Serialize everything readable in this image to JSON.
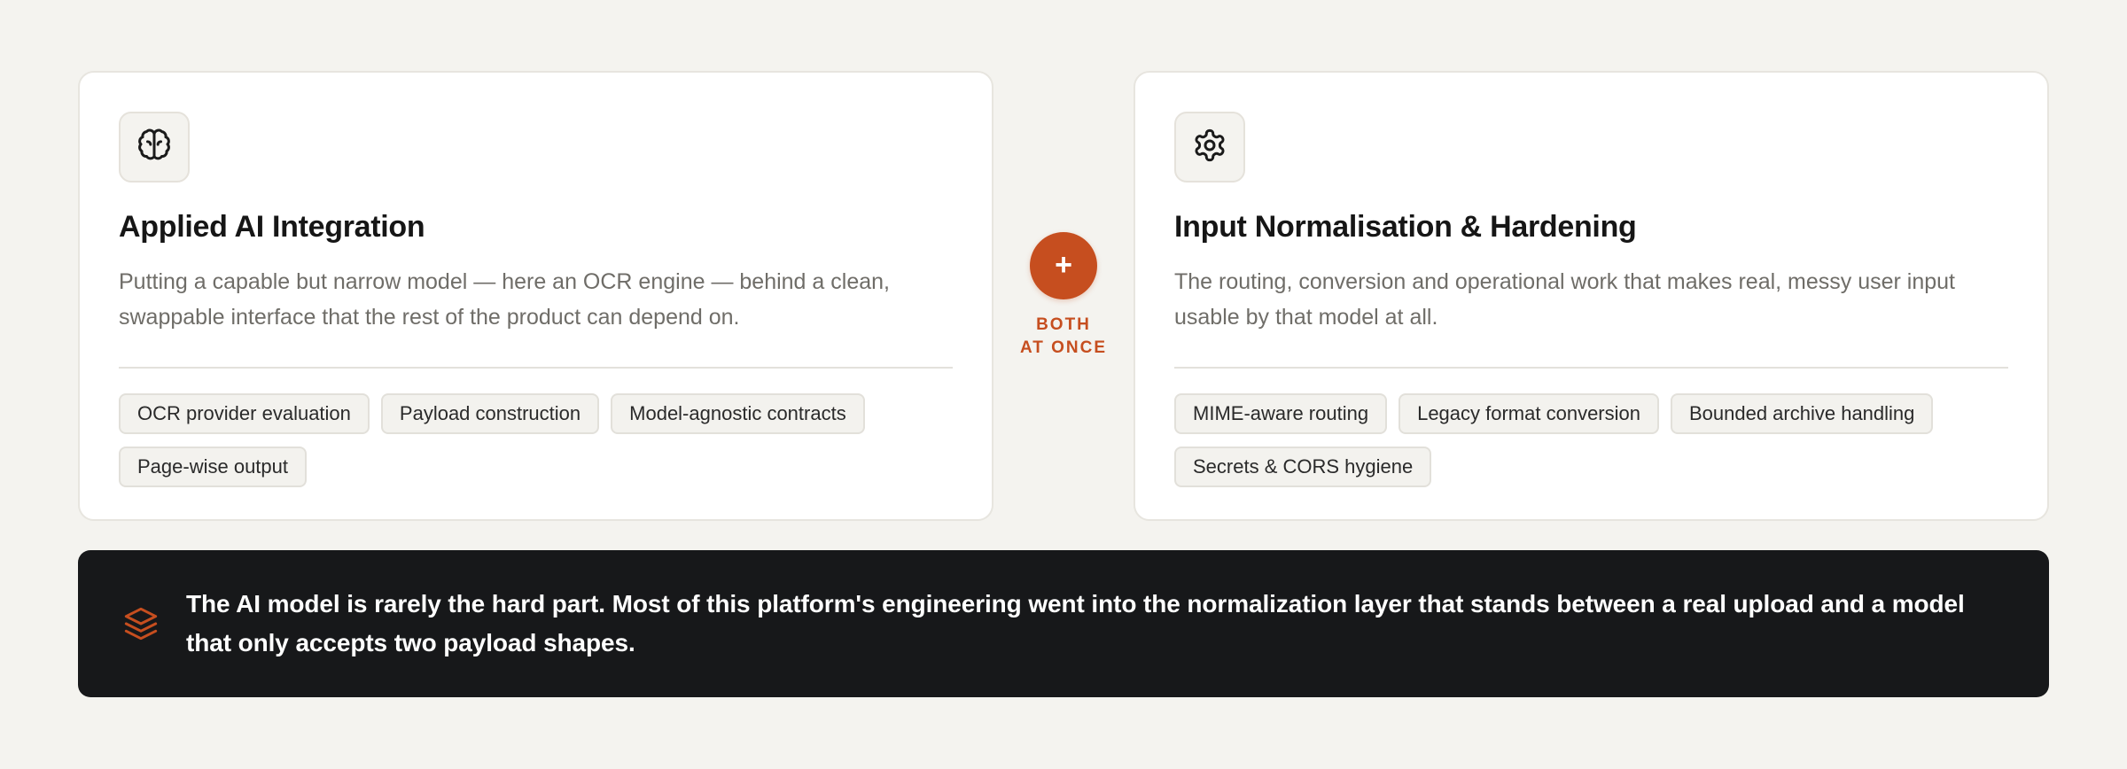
{
  "cards": [
    {
      "icon": "brain-icon",
      "title": "Applied AI Integration",
      "description": "Putting a capable but narrow model — here an OCR engine — behind a clean, swappable interface that the rest of the product can depend on.",
      "tags": [
        "OCR provider evaluation",
        "Payload construction",
        "Model-agnostic contracts",
        "Page-wise output"
      ]
    },
    {
      "icon": "gear-icon",
      "title": "Input Normalisation & Hardening",
      "description": "The routing, conversion and operational work that makes real, messy user input usable by that model at all.",
      "tags": [
        "MIME-aware routing",
        "Legacy format conversion",
        "Bounded archive handling",
        "Secrets & CORS hygiene"
      ]
    }
  ],
  "connector": {
    "symbol": "+",
    "label_line1": "BOTH",
    "label_line2": "AT ONCE"
  },
  "banner": {
    "icon": "layers-icon",
    "text": "The AI model is rarely the hard part. Most of this platform's engineering went into the normalization layer that stands between a real upload and a model that only accepts two payload shapes."
  },
  "colors": {
    "background": "#f4f3ef",
    "accent": "#c64e1f",
    "banner_bg": "#17181a",
    "card_bg": "#ffffff"
  }
}
